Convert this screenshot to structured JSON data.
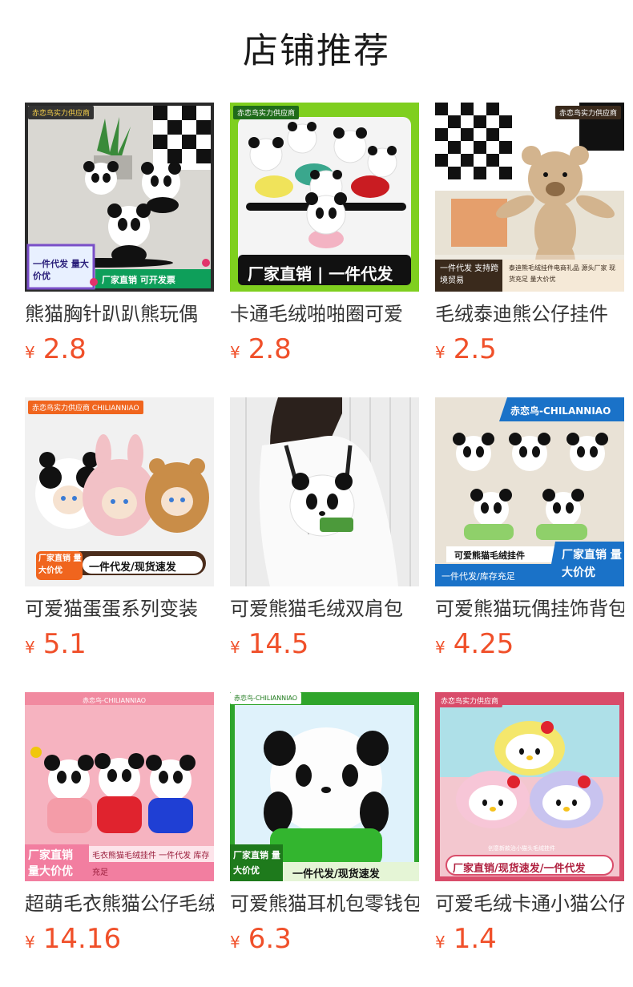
{
  "page": {
    "title": "店铺推荐"
  },
  "products": [
    {
      "name": "熊猫胸针趴趴熊玩偶",
      "currency": "¥",
      "price": "2.8",
      "image": {
        "theme": "pandas-clip",
        "tag": "赤恋鸟实力供应商",
        "promo_box": "一件代发 量大价优",
        "promo_bar": "厂家直销 可开发票"
      }
    },
    {
      "name": "卡通毛绒啪啪圈可爱",
      "currency": "¥",
      "price": "2.8",
      "image": {
        "theme": "pandas-green",
        "tag": "赤恋鸟实力供应商",
        "promo_bar": "厂家直销 | 一件代发"
      }
    },
    {
      "name": "毛绒泰迪熊公仔挂件",
      "currency": "¥",
      "price": "2.5",
      "image": {
        "theme": "teddy",
        "tag": "赤恋鸟实力供应商",
        "promo_left": "一件代发 支持跨境贸易",
        "promo_right": "泰迪熊毛绒挂件电商礼品 源头厂家 现货充足 量大价优"
      }
    },
    {
      "name": "可爱猫蛋蛋系列变装",
      "currency": "¥",
      "price": "5.1",
      "image": {
        "theme": "cat-eggs",
        "tag": "赤恋鸟实力供应商 CHILIANNIAO",
        "promo_box": "厂家直销 量大价优",
        "promo_bar": "一件代发/现货速发"
      }
    },
    {
      "name": "可爱熊猫毛绒双肩包",
      "currency": "¥",
      "price": "14.5",
      "image": {
        "theme": "backpack"
      }
    },
    {
      "name": "可爱熊猫玩偶挂饰背包",
      "currency": "¥",
      "price": "4.25",
      "image": {
        "theme": "panda-pendants",
        "tag": "赤恋鸟-CHILANNIAO",
        "promo_center": "可爱熊猫毛绒挂件",
        "promo_left": "一件代发/库存充足",
        "promo_right": "厂家直销 量大价优"
      }
    },
    {
      "name": "超萌毛衣熊猫公仔毛绒",
      "currency": "¥",
      "price": "14.16",
      "image": {
        "theme": "sweater-pandas",
        "tag": "赤恋鸟-CHILIANNIAO",
        "promo_box": "厂家直销 量大价优",
        "promo_bar": "毛衣熊猫毛绒挂件 一件代发 库存充足"
      }
    },
    {
      "name": "可爱熊猫耳机包零钱包",
      "currency": "¥",
      "price": "6.3",
      "image": {
        "theme": "panda-pouch",
        "tag": "赤恋鸟-CHILIANNIAO",
        "promo_box": "厂家直销 量大价优",
        "promo_bar": "一件代发/现货速发"
      }
    },
    {
      "name": "可爱毛绒卡通小猫公仔",
      "currency": "¥",
      "price": "1.4",
      "image": {
        "theme": "kitties",
        "tag": "赤恋鸟实力供应商",
        "promo_small": "创意新款治小猫头毛绒挂件",
        "promo_bar": "厂家直销/现货速发/一件代发"
      }
    }
  ]
}
